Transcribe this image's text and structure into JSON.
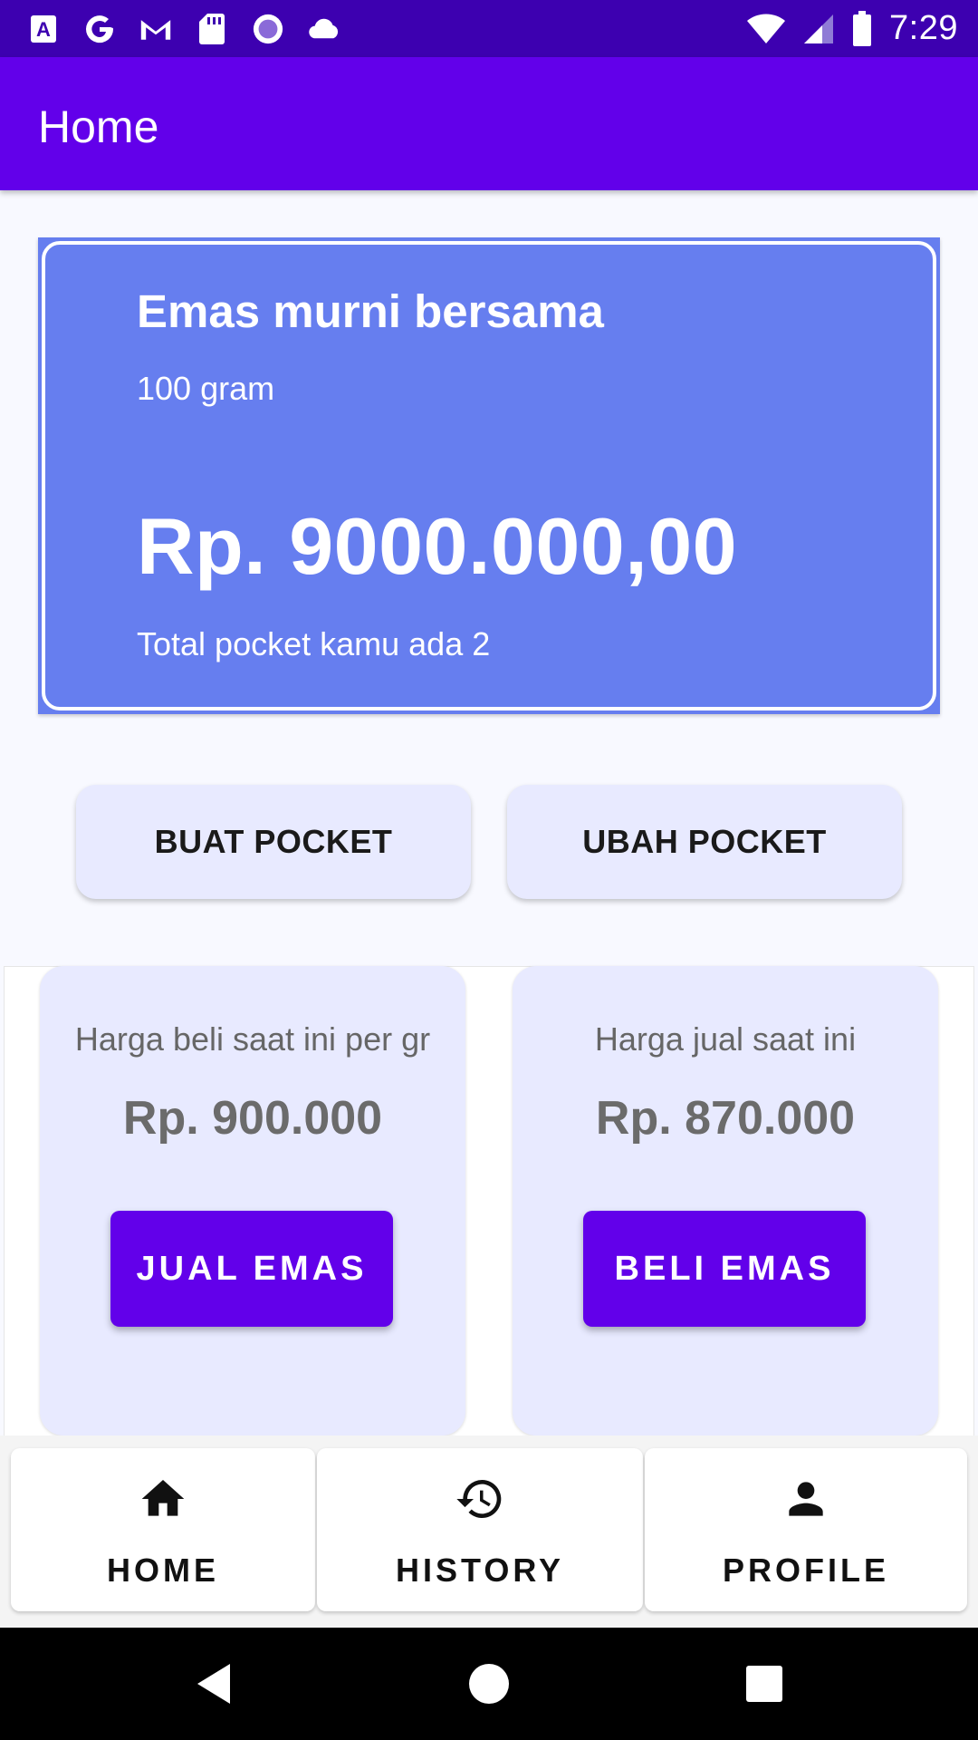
{
  "status_bar": {
    "time": "7:29",
    "left_icons": [
      "accessibility-a-icon",
      "google-g-icon",
      "gmail-icon",
      "sd-card-icon",
      "record-circle-icon",
      "cloud-icon"
    ],
    "right_icons": [
      "wifi-icon",
      "signal-icon",
      "battery-icon"
    ]
  },
  "app_bar": {
    "title": "Home"
  },
  "summary": {
    "title": "Emas murni bersama",
    "weight": "100 gram",
    "amount": "Rp. 9000.000,00",
    "pocket_count_text": "Total pocket kamu ada 2"
  },
  "pocket_actions": {
    "create": "BUAT POCKET",
    "edit": "UBAH POCKET"
  },
  "prices": {
    "buy": {
      "label": "Harga beli saat ini per gr",
      "value": "Rp. 900.000",
      "button": "JUAL EMAS"
    },
    "sell": {
      "label": "Harga jual saat ini",
      "value": "Rp. 870.000",
      "button": "BELI EMAS"
    }
  },
  "bottom_nav": {
    "items": [
      {
        "label": "HOME",
        "icon": "home-icon"
      },
      {
        "label": "HISTORY",
        "icon": "history-icon"
      },
      {
        "label": "PROFILE",
        "icon": "person-icon"
      }
    ]
  },
  "colors": {
    "status_bar": "#3d00b0",
    "app_bar": "#6200ea",
    "summary_card": "#667eef",
    "light_card": "#e8eaff",
    "button": "#6200ea"
  }
}
